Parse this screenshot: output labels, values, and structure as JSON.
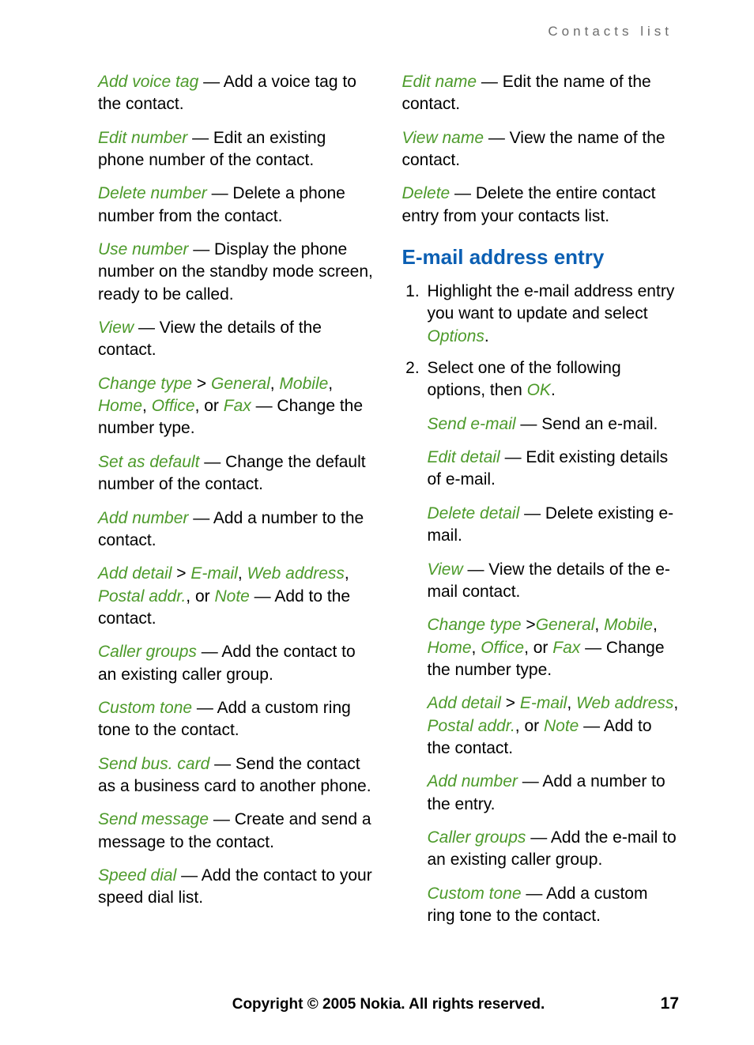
{
  "header": {
    "running": "Contacts list"
  },
  "footer": {
    "copyright": "Copyright © 2005 Nokia. All rights reserved.",
    "page": "17"
  },
  "left": {
    "items": [
      {
        "term": "Add voice tag",
        "text": " — Add a voice tag to the contact."
      },
      {
        "term": "Edit number",
        "text": " — Edit an existing phone number of the contact."
      },
      {
        "term": "Delete number",
        "text": " — Delete a phone number from the contact."
      },
      {
        "term": "Use number",
        "text": " — Display the phone number on the standby mode screen, ready to be called."
      },
      {
        "term": "View",
        "text": " — View the details of the contact."
      }
    ],
    "change_type": {
      "lead": "Change type",
      "gt": " > ",
      "opts": [
        "General",
        "Mobile",
        "Home",
        "Office"
      ],
      "or": ", or ",
      "fax": "Fax",
      "tail": " — Change the number type."
    },
    "items2": [
      {
        "term": "Set as default",
        "text": " — Change the default number of the contact."
      },
      {
        "term": "Add number",
        "text": " — Add a number to the contact."
      }
    ],
    "add_detail": {
      "lead": "Add detail",
      "gt": " > ",
      "opts": [
        "E-mail",
        "Web address",
        "Postal addr."
      ],
      "or": ", or ",
      "note": "Note",
      "tail": " — Add to the contact."
    },
    "items3": [
      {
        "term": "Caller groups",
        "text": " — Add the contact to an existing caller group."
      },
      {
        "term": "Custom tone",
        "text": " — Add a custom ring tone to the contact."
      },
      {
        "term": "Send bus. card",
        "text": " — Send the contact as a business card to another phone."
      },
      {
        "term": "Send message",
        "text": " — Create and send a message to the contact."
      },
      {
        "term": "Speed dial",
        "text": " — Add the contact to your speed dial list."
      }
    ]
  },
  "right": {
    "items": [
      {
        "term": "Edit name",
        "text": " — Edit the name of the contact."
      },
      {
        "term": "View name",
        "text": " — View the name of the contact."
      },
      {
        "term": "Delete",
        "text": " — Delete the entire contact entry from your contacts list."
      }
    ],
    "h2": "E-mail address entry",
    "step1_a": "Highlight the e-mail address entry you want to update and select ",
    "step1_b": "Options",
    "step1_c": ".",
    "step2_a": "Select one of the following options, then ",
    "step2_b": "OK",
    "step2_c": ".",
    "sub": [
      {
        "term": "Send e-mail",
        "text": " — Send an e-mail."
      },
      {
        "term": "Edit detail",
        "text": " — Edit existing details of e-mail."
      },
      {
        "term": "Delete detail",
        "text": " — Delete existing e-mail."
      },
      {
        "term": "View",
        "text": " — View the details of the e-mail contact."
      }
    ],
    "change_type": {
      "lead": "Change type",
      "gt": " >",
      "opts": [
        "General",
        "Mobile",
        "Home",
        "Office"
      ],
      "or": ", or ",
      "fax": "Fax",
      "tail": " — Change the number type."
    },
    "add_detail": {
      "lead": "Add detail",
      "gt": " > ",
      "opts": [
        "E-mail",
        "Web address",
        "Postal addr."
      ],
      "or": ", or ",
      "note": "Note",
      "tail": " — Add to the contact."
    },
    "sub2": [
      {
        "term": "Add number",
        "text": " — Add a number to the entry."
      },
      {
        "term": "Caller groups",
        "text": " — Add the e-mail to an existing caller group."
      },
      {
        "term": "Custom tone",
        "text": " — Add a custom ring tone to the contact."
      }
    ]
  }
}
